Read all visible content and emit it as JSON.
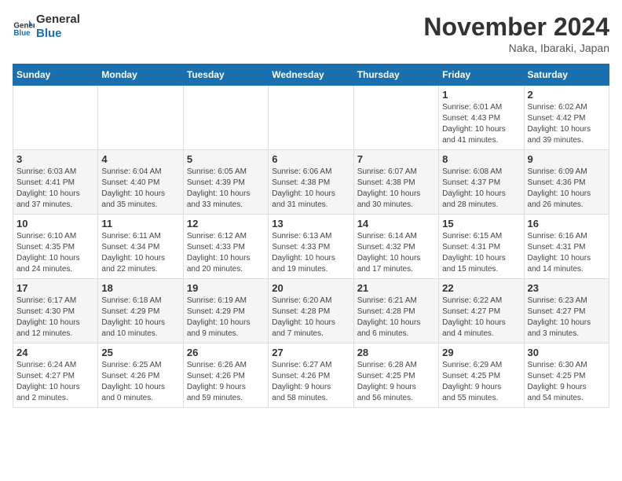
{
  "header": {
    "logo_line1": "General",
    "logo_line2": "Blue",
    "month": "November 2024",
    "location": "Naka, Ibaraki, Japan"
  },
  "columns": [
    "Sunday",
    "Monday",
    "Tuesday",
    "Wednesday",
    "Thursday",
    "Friday",
    "Saturday"
  ],
  "weeks": [
    [
      {
        "day": "",
        "info": ""
      },
      {
        "day": "",
        "info": ""
      },
      {
        "day": "",
        "info": ""
      },
      {
        "day": "",
        "info": ""
      },
      {
        "day": "",
        "info": ""
      },
      {
        "day": "1",
        "info": "Sunrise: 6:01 AM\nSunset: 4:43 PM\nDaylight: 10 hours\nand 41 minutes."
      },
      {
        "day": "2",
        "info": "Sunrise: 6:02 AM\nSunset: 4:42 PM\nDaylight: 10 hours\nand 39 minutes."
      }
    ],
    [
      {
        "day": "3",
        "info": "Sunrise: 6:03 AM\nSunset: 4:41 PM\nDaylight: 10 hours\nand 37 minutes."
      },
      {
        "day": "4",
        "info": "Sunrise: 6:04 AM\nSunset: 4:40 PM\nDaylight: 10 hours\nand 35 minutes."
      },
      {
        "day": "5",
        "info": "Sunrise: 6:05 AM\nSunset: 4:39 PM\nDaylight: 10 hours\nand 33 minutes."
      },
      {
        "day": "6",
        "info": "Sunrise: 6:06 AM\nSunset: 4:38 PM\nDaylight: 10 hours\nand 31 minutes."
      },
      {
        "day": "7",
        "info": "Sunrise: 6:07 AM\nSunset: 4:38 PM\nDaylight: 10 hours\nand 30 minutes."
      },
      {
        "day": "8",
        "info": "Sunrise: 6:08 AM\nSunset: 4:37 PM\nDaylight: 10 hours\nand 28 minutes."
      },
      {
        "day": "9",
        "info": "Sunrise: 6:09 AM\nSunset: 4:36 PM\nDaylight: 10 hours\nand 26 minutes."
      }
    ],
    [
      {
        "day": "10",
        "info": "Sunrise: 6:10 AM\nSunset: 4:35 PM\nDaylight: 10 hours\nand 24 minutes."
      },
      {
        "day": "11",
        "info": "Sunrise: 6:11 AM\nSunset: 4:34 PM\nDaylight: 10 hours\nand 22 minutes."
      },
      {
        "day": "12",
        "info": "Sunrise: 6:12 AM\nSunset: 4:33 PM\nDaylight: 10 hours\nand 20 minutes."
      },
      {
        "day": "13",
        "info": "Sunrise: 6:13 AM\nSunset: 4:33 PM\nDaylight: 10 hours\nand 19 minutes."
      },
      {
        "day": "14",
        "info": "Sunrise: 6:14 AM\nSunset: 4:32 PM\nDaylight: 10 hours\nand 17 minutes."
      },
      {
        "day": "15",
        "info": "Sunrise: 6:15 AM\nSunset: 4:31 PM\nDaylight: 10 hours\nand 15 minutes."
      },
      {
        "day": "16",
        "info": "Sunrise: 6:16 AM\nSunset: 4:31 PM\nDaylight: 10 hours\nand 14 minutes."
      }
    ],
    [
      {
        "day": "17",
        "info": "Sunrise: 6:17 AM\nSunset: 4:30 PM\nDaylight: 10 hours\nand 12 minutes."
      },
      {
        "day": "18",
        "info": "Sunrise: 6:18 AM\nSunset: 4:29 PM\nDaylight: 10 hours\nand 10 minutes."
      },
      {
        "day": "19",
        "info": "Sunrise: 6:19 AM\nSunset: 4:29 PM\nDaylight: 10 hours\nand 9 minutes."
      },
      {
        "day": "20",
        "info": "Sunrise: 6:20 AM\nSunset: 4:28 PM\nDaylight: 10 hours\nand 7 minutes."
      },
      {
        "day": "21",
        "info": "Sunrise: 6:21 AM\nSunset: 4:28 PM\nDaylight: 10 hours\nand 6 minutes."
      },
      {
        "day": "22",
        "info": "Sunrise: 6:22 AM\nSunset: 4:27 PM\nDaylight: 10 hours\nand 4 minutes."
      },
      {
        "day": "23",
        "info": "Sunrise: 6:23 AM\nSunset: 4:27 PM\nDaylight: 10 hours\nand 3 minutes."
      }
    ],
    [
      {
        "day": "24",
        "info": "Sunrise: 6:24 AM\nSunset: 4:27 PM\nDaylight: 10 hours\nand 2 minutes."
      },
      {
        "day": "25",
        "info": "Sunrise: 6:25 AM\nSunset: 4:26 PM\nDaylight: 10 hours\nand 0 minutes."
      },
      {
        "day": "26",
        "info": "Sunrise: 6:26 AM\nSunset: 4:26 PM\nDaylight: 9 hours\nand 59 minutes."
      },
      {
        "day": "27",
        "info": "Sunrise: 6:27 AM\nSunset: 4:26 PM\nDaylight: 9 hours\nand 58 minutes."
      },
      {
        "day": "28",
        "info": "Sunrise: 6:28 AM\nSunset: 4:25 PM\nDaylight: 9 hours\nand 56 minutes."
      },
      {
        "day": "29",
        "info": "Sunrise: 6:29 AM\nSunset: 4:25 PM\nDaylight: 9 hours\nand 55 minutes."
      },
      {
        "day": "30",
        "info": "Sunrise: 6:30 AM\nSunset: 4:25 PM\nDaylight: 9 hours\nand 54 minutes."
      }
    ]
  ]
}
